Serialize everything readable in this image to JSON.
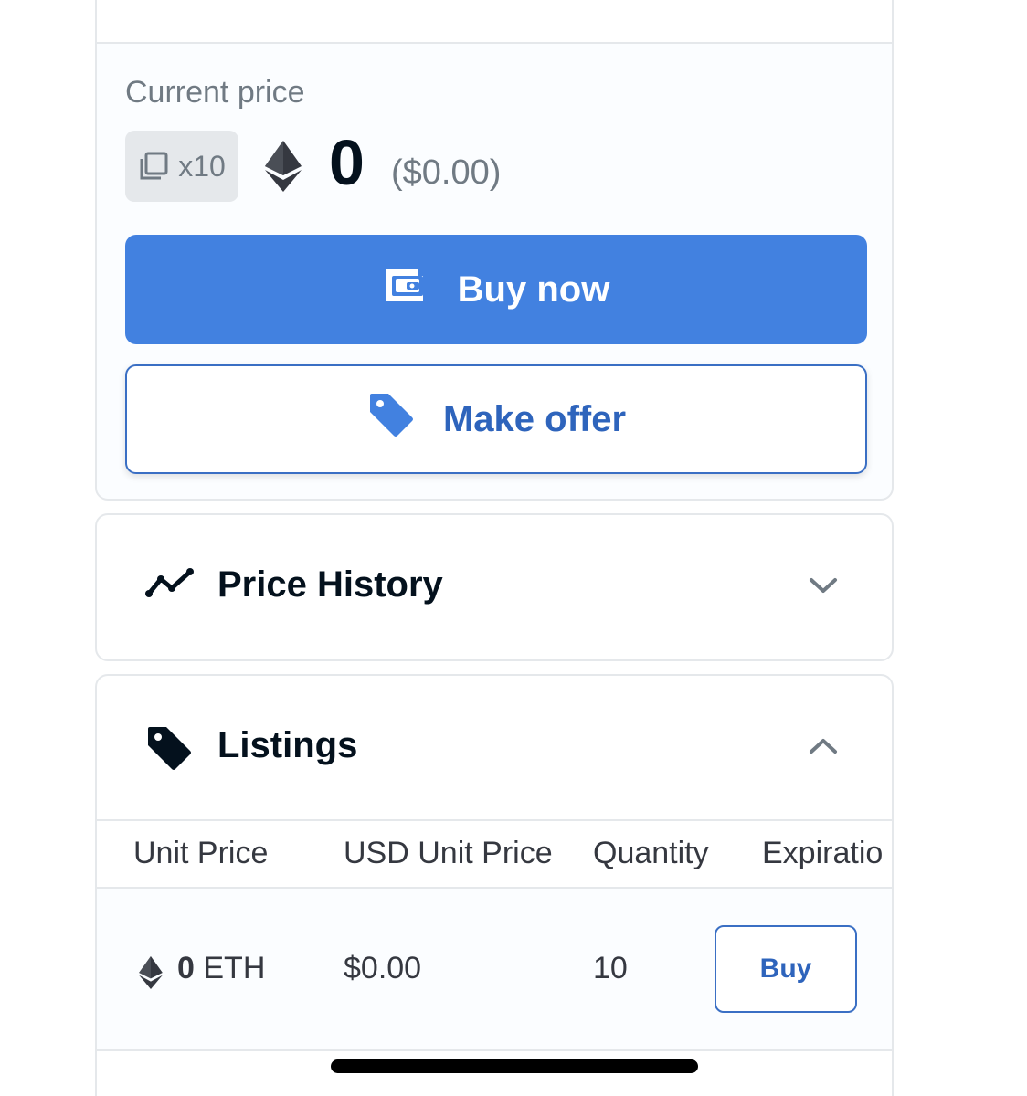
{
  "price_card": {
    "label": "Current price",
    "quantity_badge": "x10",
    "price": "0",
    "price_usd": "($0.00)",
    "buy_now_label": "Buy now",
    "make_offer_label": "Make offer"
  },
  "price_history": {
    "title": "Price History",
    "expanded": false
  },
  "listings": {
    "title": "Listings",
    "expanded": true,
    "columns": [
      "Unit Price",
      "USD Unit Price",
      "Quantity",
      "Expiratio"
    ],
    "rows": [
      {
        "unit_price_amount": "0",
        "unit_price_currency": "ETH",
        "usd_unit_price": "$0.00",
        "quantity": "10",
        "action_label": "Buy"
      }
    ]
  },
  "colors": {
    "primary": "#4281e0",
    "primary_text": "#2e64bc",
    "muted_text": "#707a83",
    "dark_text": "#04111d",
    "border": "#e5e8eb"
  },
  "icons": {
    "quantity": "copies-icon",
    "currency": "ethereum-icon",
    "buy_now": "wallet-icon",
    "make_offer": "tag-icon",
    "price_history": "trend-line-icon",
    "price_history_toggle": "chevron-down-icon",
    "listings": "tag-icon",
    "listings_toggle": "chevron-up-icon"
  }
}
